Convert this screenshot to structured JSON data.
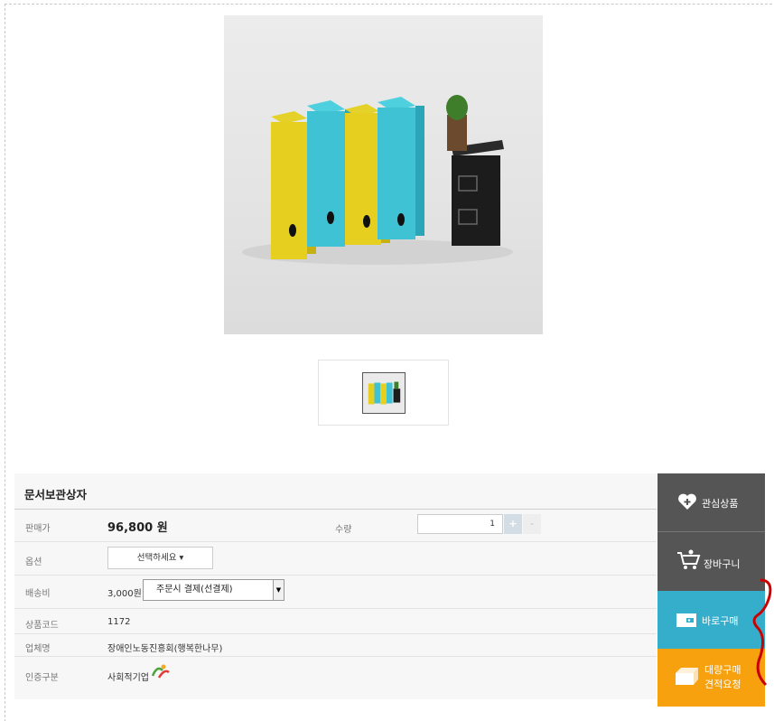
{
  "product": {
    "title": "문서보관상자",
    "price_label": "판매가",
    "price": "96,800 원",
    "quantity_label": "수량",
    "quantity_value": "1",
    "quantity_plus": "+",
    "quantity_minus": "-",
    "option_label": "옵션",
    "option_button": "선택하세요 ▾",
    "shipping_label": "배송비",
    "shipping_fee": "3,000원",
    "shipping_select": "주문시 결제(선결제)",
    "code_label": "상품코드",
    "code": "1172",
    "vendor_label": "업체명",
    "vendor": "장애인노동진흥회(행복한나무)",
    "cert_label": "인증구분",
    "cert": "사회적기업"
  },
  "actions": {
    "wishlist": "관심상품",
    "cart": "장바구니",
    "buy_now": "바로구매",
    "bulk_line1": "대량구매",
    "bulk_line2": "견적요청"
  },
  "colors": {
    "wishlist_bg": "#555555",
    "cart_bg": "#555555",
    "buy_bg": "#35aecb",
    "bulk_bg": "#f6a10d",
    "annotation": "#cc0000"
  },
  "icons": [
    "heart-plus-icon",
    "shopping-cart-icon",
    "wallet-icon",
    "box-icon"
  ]
}
